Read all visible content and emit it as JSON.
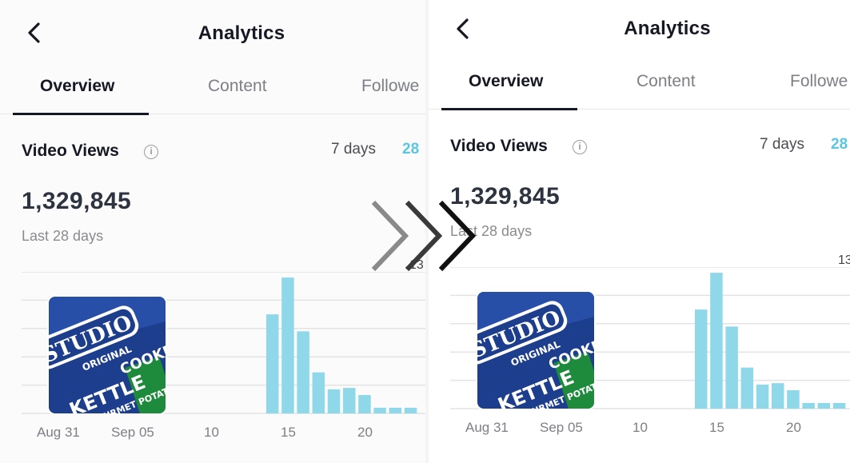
{
  "header": {
    "title": "Analytics"
  },
  "tabs": [
    {
      "label": "Overview",
      "active": true
    },
    {
      "label": "Content",
      "active": false
    },
    {
      "label": "Followe",
      "active": false
    }
  ],
  "video_views": {
    "title": "Video Views",
    "range_options": [
      "7 days",
      "28"
    ],
    "selected_range": "28",
    "total": "1,329,845",
    "period": "Last 28 days",
    "peak_label": "13"
  },
  "thumbnail": {
    "brand": "STUDIO",
    "line1": "ORIGINAL",
    "line2": "KETTLE",
    "line3": "COOKED",
    "line4": "GOURMET POTATO"
  },
  "chart_data": {
    "type": "bar",
    "x_ticks": [
      "Aug 31",
      "Sep 05",
      "10",
      "15",
      "20"
    ],
    "values": [
      0,
      0,
      0,
      0,
      0,
      0,
      0,
      0,
      0,
      0,
      0,
      0,
      0,
      0,
      0,
      70,
      96,
      58,
      29,
      17,
      18,
      13,
      4,
      4,
      4
    ],
    "series_color": "#8fd8ea",
    "grid": true
  },
  "colors": {
    "accent": "#5bc6e0",
    "text": "#161823",
    "muted": "#7d7f85"
  },
  "icons": {
    "back": "chevron-left-icon",
    "info": "info-icon",
    "transition": "double-chevron-right-icon"
  }
}
